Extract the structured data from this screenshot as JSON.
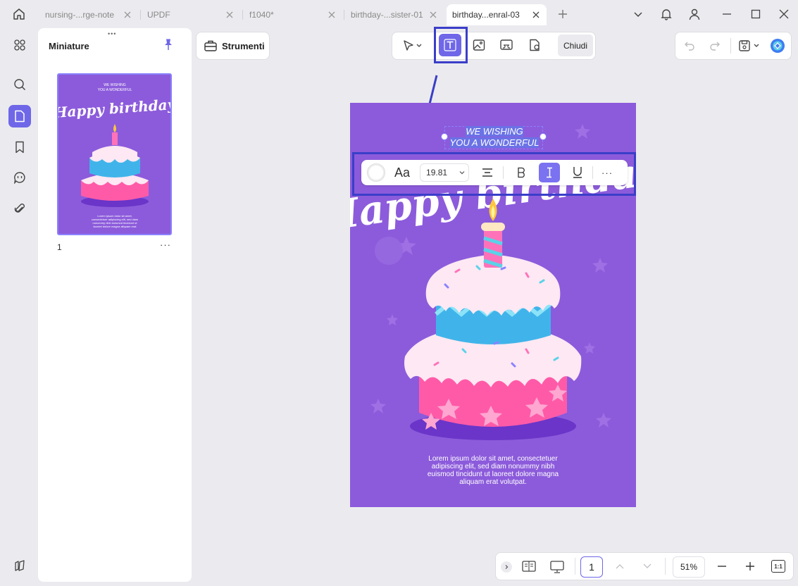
{
  "tabs": [
    {
      "label": "nursing-...rge-note",
      "active": false
    },
    {
      "label": "UPDF",
      "active": false
    },
    {
      "label": "f1040*",
      "active": false
    },
    {
      "label": "birthday-...sister-01",
      "active": false
    },
    {
      "label": "birthday...enral-03",
      "active": true
    }
  ],
  "sidebar": {
    "icons": [
      "apps-icon",
      "search-icon",
      "pages-icon",
      "bookmark-icon",
      "comment-icon",
      "attachment-icon",
      "layers-icon"
    ]
  },
  "thumbnails": {
    "title": "Miniature",
    "page_number": "1",
    "more": "···"
  },
  "toolbar": {
    "tools_label": "Strumenti",
    "close_label": "Chiudi"
  },
  "format_bar": {
    "font_label": "Aa",
    "font_size": "19.81",
    "more": "···"
  },
  "document": {
    "wish_line1": "WE WISHING",
    "wish_line2": "YOU A WONDERFUL",
    "heading": "Happy birthday",
    "body": "Lorem ipsum dolor sit amet, consectetuer adipiscing elit, sed diam nonummy nibh euismod tincidunt ut laoreet dolore magna aliquam erat volutpat."
  },
  "bottom_bar": {
    "page_input": "1",
    "zoom": "51%",
    "actual_size": "1:1"
  },
  "colors": {
    "accent": "#6f67e8",
    "highlight_border": "#3a3ec9",
    "page_purple": "#8c5bdb"
  }
}
